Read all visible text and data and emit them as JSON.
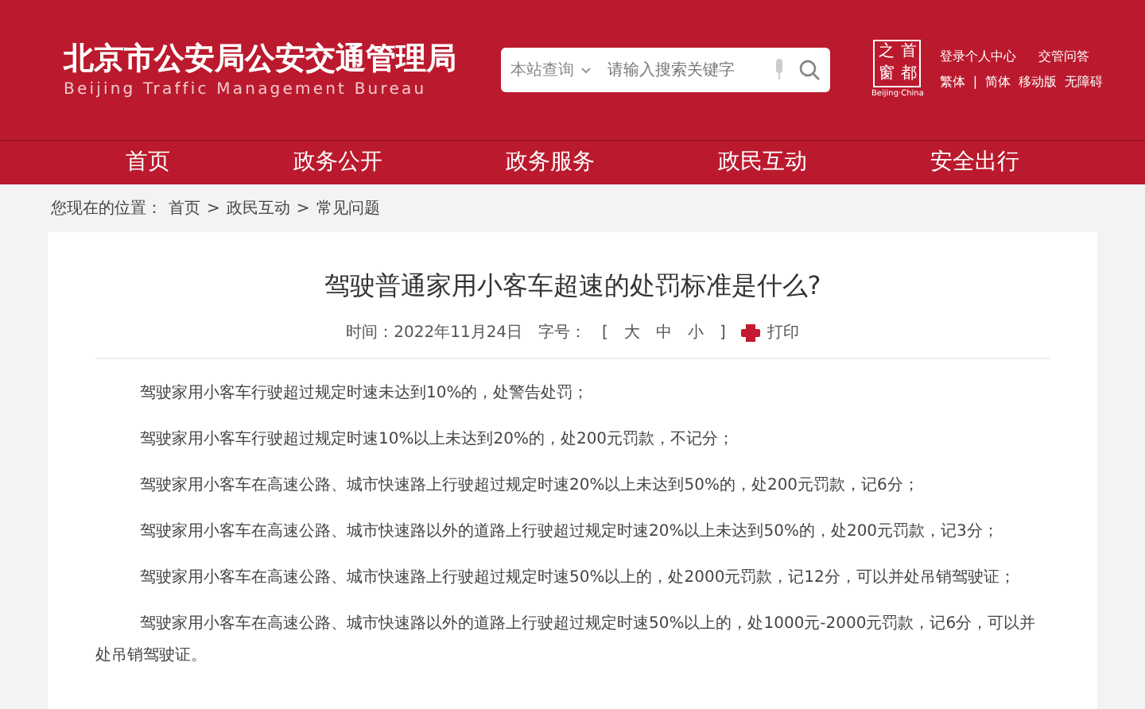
{
  "header": {
    "title": "北京市公安局公安交通管理局",
    "subtitle": "Beijing Traffic Management Bureau",
    "search": {
      "scope": "本站查询",
      "placeholder": "请输入搜索关键字"
    },
    "capital_logo": {
      "chars": [
        "之",
        "首",
        "窗",
        "都"
      ],
      "caption": "Beijing·China"
    },
    "links_top": [
      "登录个人中心",
      "交管问答"
    ],
    "links_bottom": [
      "繁体",
      "|",
      "简体",
      "移动版",
      "无障碍"
    ]
  },
  "nav": [
    {
      "label": "首页"
    },
    {
      "label": "政务公开"
    },
    {
      "label": "政务服务"
    },
    {
      "label": "政民互动"
    },
    {
      "label": "安全出行"
    }
  ],
  "breadcrumb": {
    "prefix": "您现在的位置：",
    "items": [
      "首页",
      "政民互动",
      "常见问题"
    ],
    "separator": ">"
  },
  "article": {
    "title": "驾驶普通家用小客车超速的处罚标准是什么?",
    "meta": {
      "date": "时间：2022年11月24日",
      "font_label": "字号：",
      "font_open": "[",
      "font_sizes": [
        "大",
        "中",
        "小"
      ],
      "font_close": "]",
      "print": "打印"
    },
    "paragraphs": [
      "驾驶家用小客车行驶超过规定时速未达到10%的，处警告处罚；",
      "驾驶家用小客车行驶超过规定时速10%以上未达到20%的，处200元罚款，不记分；",
      "驾驶家用小客车在高速公路、城市快速路上行驶超过规定时速20%以上未达到50%的，处200元罚款，记6分；",
      "驾驶家用小客车在高速公路、城市快速路以外的道路上行驶超过规定时速20%以上未达到50%的，处200元罚款，记3分；",
      "驾驶家用小客车在高速公路、城市快速路上行驶超过规定时速50%以上的，处2000元罚款，记12分，可以并处吊销驾驶证；",
      "驾驶家用小客车在高速公路、城市快速路以外的道路上行驶超过规定时速50%以上的，处1000元-2000元罚款，记6分，可以并处吊销驾驶证。"
    ]
  }
}
